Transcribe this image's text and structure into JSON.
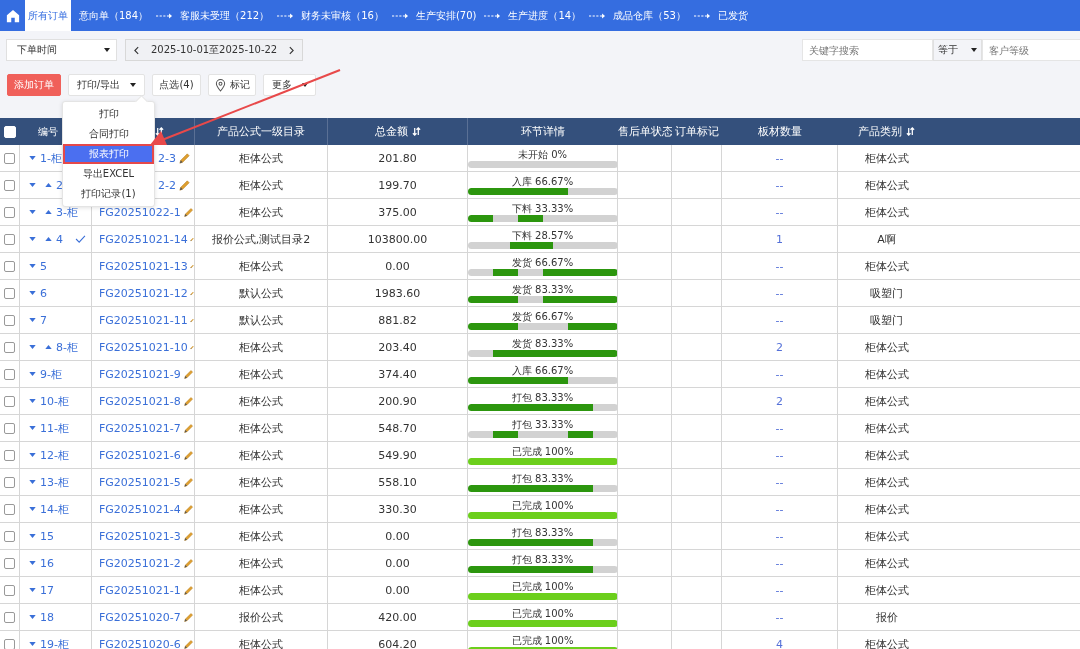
{
  "tabs": [
    {
      "label": "所有订单",
      "selected": true
    },
    {
      "label": "意向单（184）",
      "selected": false
    },
    {
      "label": "客服未受理（212）",
      "selected": false
    },
    {
      "label": "财务未审核（16）",
      "selected": false
    },
    {
      "label": "生产安排(70)",
      "selected": false
    },
    {
      "label": "生产进度（14）",
      "selected": false
    },
    {
      "label": "成品仓库（53）",
      "selected": false
    },
    {
      "label": "已发货",
      "selected": false
    }
  ],
  "filters": {
    "time_select": "下单时间",
    "date_range": "2025-10-01至2025-10-22",
    "search_placeholder": "关键字搜索",
    "operator": "等于",
    "field_placeholder": "客户等级"
  },
  "actions": {
    "add": "添加订单",
    "print_export": "打印/导出",
    "pick": "点选(4)",
    "mark": "标记",
    "more": "更多"
  },
  "menu": [
    {
      "label": "打印",
      "selected": false
    },
    {
      "label": "合同打印",
      "selected": false
    },
    {
      "label": "报表打印",
      "selected": true
    },
    {
      "label": "导出EXCEL",
      "selected": false
    },
    {
      "label": "打印记录(1)",
      "selected": false
    }
  ],
  "columns": {
    "number": "编号",
    "formula": "产品公式一级目录",
    "amount": "总金额",
    "stage": "环节详情",
    "aftersale": "售后单状态",
    "order_mark": "订单标记",
    "sheets": "板材数量",
    "category": "产品类别"
  },
  "header_checked": false,
  "rows": [
    {
      "checked": false,
      "number": "1-柜",
      "nested": false,
      "verified": false,
      "order_no": "2-3",
      "clipped": true,
      "formula": "柜体公式",
      "amount": "201.80",
      "stage": "未开始 0%",
      "segments": [
        false,
        false,
        false,
        false,
        false,
        false
      ],
      "sheets": "--",
      "category": "柜体公式"
    },
    {
      "checked": false,
      "number": "2",
      "nested": true,
      "verified": false,
      "order_no": "2-2",
      "clipped": true,
      "formula": "柜体公式",
      "amount": "199.70",
      "stage": "入库 66.67%",
      "segments": [
        true,
        true,
        true,
        true,
        false,
        false
      ],
      "sheets": "--",
      "category": "柜体公式"
    },
    {
      "checked": false,
      "number": "3-柜",
      "nested": true,
      "verified": false,
      "order_no": "FG20251022-1",
      "clipped": false,
      "formula": "柜体公式",
      "amount": "375.00",
      "stage": "下料 33.33%",
      "segments": [
        true,
        false,
        true,
        false,
        false,
        false
      ],
      "sheets": "--",
      "category": "柜体公式"
    },
    {
      "checked": false,
      "number": "4",
      "nested": true,
      "verified": true,
      "order_no": "FG20251021-14",
      "clipped": false,
      "formula": "报价公式,测试目录2",
      "amount": "103800.00",
      "stage": "下料 28.57%",
      "segments": [
        false,
        false,
        true,
        true,
        false,
        false,
        false
      ],
      "sheets": "1",
      "category": "A啊"
    },
    {
      "checked": false,
      "number": "5",
      "nested": false,
      "verified": false,
      "order_no": "FG20251021-13",
      "clipped": false,
      "formula": "柜体公式",
      "amount": "0.00",
      "stage": "发货 66.67%",
      "segments": [
        false,
        true,
        false,
        true,
        true,
        true
      ],
      "sheets": "--",
      "category": "柜体公式"
    },
    {
      "checked": false,
      "number": "6",
      "nested": false,
      "verified": false,
      "order_no": "FG20251021-12",
      "clipped": false,
      "formula": "默认公式",
      "amount": "1983.60",
      "stage": "发货 83.33%",
      "segments": [
        true,
        true,
        false,
        true,
        true,
        true
      ],
      "sheets": "--",
      "category": "吸塑门"
    },
    {
      "checked": false,
      "number": "7",
      "nested": false,
      "verified": false,
      "order_no": "FG20251021-11",
      "clipped": false,
      "formula": "默认公式",
      "amount": "881.82",
      "stage": "发货 66.67%",
      "segments": [
        true,
        true,
        false,
        false,
        true,
        true
      ],
      "sheets": "--",
      "category": "吸塑门"
    },
    {
      "checked": false,
      "number": "8-柜",
      "nested": true,
      "verified": false,
      "order_no": "FG20251021-10",
      "clipped": false,
      "formula": "柜体公式",
      "amount": "203.40",
      "stage": "发货 83.33%",
      "segments": [
        false,
        true,
        true,
        true,
        true,
        true
      ],
      "sheets": "2",
      "category": "柜体公式"
    },
    {
      "checked": false,
      "number": "9-柜",
      "nested": false,
      "verified": false,
      "order_no": "FG20251021-9",
      "clipped": false,
      "formula": "柜体公式",
      "amount": "374.40",
      "stage": "入库 66.67%",
      "segments": [
        true,
        true,
        true,
        true,
        false,
        false
      ],
      "sheets": "--",
      "category": "柜体公式"
    },
    {
      "checked": false,
      "number": "10-柜",
      "nested": false,
      "verified": false,
      "order_no": "FG20251021-8",
      "clipped": false,
      "formula": "柜体公式",
      "amount": "200.90",
      "stage": "打包 83.33%",
      "segments": [
        true,
        true,
        true,
        true,
        true,
        false
      ],
      "sheets": "2",
      "category": "柜体公式"
    },
    {
      "checked": false,
      "number": "11-柜",
      "nested": false,
      "verified": false,
      "order_no": "FG20251021-7",
      "clipped": false,
      "formula": "柜体公式",
      "amount": "548.70",
      "stage": "打包 33.33%",
      "segments": [
        false,
        true,
        false,
        false,
        true,
        false
      ],
      "sheets": "--",
      "category": "柜体公式"
    },
    {
      "checked": false,
      "number": "12-柜",
      "nested": false,
      "verified": false,
      "order_no": "FG20251021-6",
      "clipped": false,
      "formula": "柜体公式",
      "amount": "549.90",
      "stage": "已完成 100%",
      "segments": [
        true,
        true,
        true,
        true,
        true,
        true
      ],
      "sheets": "--",
      "category": "柜体公式"
    },
    {
      "checked": false,
      "number": "13-柜",
      "nested": false,
      "verified": false,
      "order_no": "FG20251021-5",
      "clipped": false,
      "formula": "柜体公式",
      "amount": "558.10",
      "stage": "打包 83.33%",
      "segments": [
        true,
        true,
        true,
        true,
        true,
        false
      ],
      "sheets": "--",
      "category": "柜体公式"
    },
    {
      "checked": false,
      "number": "14-柜",
      "nested": false,
      "verified": false,
      "order_no": "FG20251021-4",
      "clipped": false,
      "formula": "柜体公式",
      "amount": "330.30",
      "stage": "已完成 100%",
      "segments": [
        true,
        true,
        true,
        true,
        true,
        true
      ],
      "sheets": "--",
      "category": "柜体公式"
    },
    {
      "checked": false,
      "number": "15",
      "nested": false,
      "verified": false,
      "order_no": "FG20251021-3",
      "clipped": false,
      "formula": "柜体公式",
      "amount": "0.00",
      "stage": "打包 83.33%",
      "segments": [
        true,
        true,
        true,
        true,
        true,
        false
      ],
      "sheets": "--",
      "category": "柜体公式"
    },
    {
      "checked": false,
      "number": "16",
      "nested": false,
      "verified": false,
      "order_no": "FG20251021-2",
      "clipped": false,
      "formula": "柜体公式",
      "amount": "0.00",
      "stage": "打包 83.33%",
      "segments": [
        true,
        true,
        true,
        true,
        true,
        false
      ],
      "sheets": "--",
      "category": "柜体公式"
    },
    {
      "checked": false,
      "number": "17",
      "nested": false,
      "verified": false,
      "order_no": "FG20251021-1",
      "clipped": false,
      "formula": "柜体公式",
      "amount": "0.00",
      "stage": "已完成 100%",
      "segments": [
        true,
        true,
        true,
        true,
        true,
        true
      ],
      "sheets": "--",
      "category": "柜体公式"
    },
    {
      "checked": false,
      "number": "18",
      "nested": false,
      "verified": false,
      "order_no": "FG20251020-7",
      "clipped": false,
      "formula": "报价公式",
      "amount": "420.00",
      "stage": "已完成 100%",
      "segments": [
        true,
        true,
        true,
        true,
        true,
        true
      ],
      "sheets": "--",
      "category": "报价"
    },
    {
      "checked": false,
      "number": "19-柜",
      "nested": false,
      "verified": false,
      "order_no": "FG20251020-6",
      "clipped": false,
      "formula": "柜体公式",
      "amount": "604.20",
      "stage": "已完成 100%",
      "segments": [
        true,
        true,
        true,
        true,
        true,
        true
      ],
      "sheets": "4",
      "category": "柜体公式"
    }
  ]
}
